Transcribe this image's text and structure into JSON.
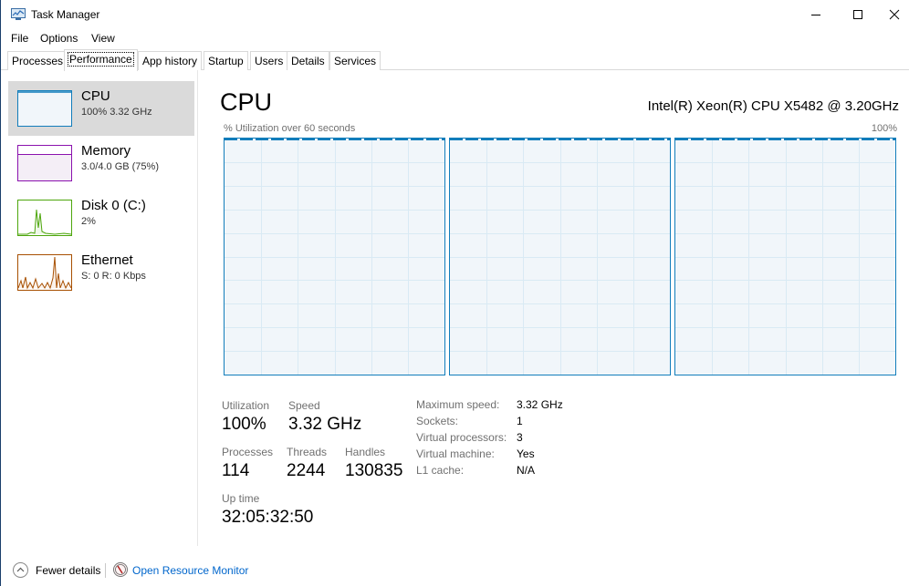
{
  "window": {
    "title": "Task Manager"
  },
  "menu": [
    "File",
    "Options",
    "View"
  ],
  "tabs": [
    "Processes",
    "Performance",
    "App history",
    "Startup",
    "Users",
    "Details",
    "Services"
  ],
  "active_tab": "Performance",
  "resources": [
    {
      "name": "CPU",
      "sub": "100%  3.32 GHz",
      "color": "#117dbb"
    },
    {
      "name": "Memory",
      "sub": "3.0/4.0 GB (75%)",
      "color": "#8b12ae"
    },
    {
      "name": "Disk 0 (C:)",
      "sub": "2%",
      "color": "#4da60c"
    },
    {
      "name": "Ethernet",
      "sub": "S: 0  R: 0 Kbps",
      "color": "#a74f01"
    }
  ],
  "cpu": {
    "title": "CPU",
    "model": "Intel(R) Xeon(R) CPU X5482 @ 3.20GHz",
    "graph_label": "% Utilization over 60 seconds",
    "graph_max": "100%",
    "utilization_label": "Utilization",
    "utilization": "100%",
    "speed_label": "Speed",
    "speed": "3.32 GHz",
    "processes_label": "Processes",
    "processes": "114",
    "threads_label": "Threads",
    "threads": "2244",
    "handles_label": "Handles",
    "handles": "130835",
    "uptime_label": "Up time",
    "uptime": "32:05:32:50",
    "info": [
      {
        "key": "Maximum speed:",
        "value": "3.32 GHz"
      },
      {
        "key": "Sockets:",
        "value": "1"
      },
      {
        "key": "Virtual processors:",
        "value": "3"
      },
      {
        "key": "Virtual machine:",
        "value": "Yes"
      },
      {
        "key": "L1 cache:",
        "value": "N/A"
      }
    ]
  },
  "footer": {
    "fewer_details": "Fewer details",
    "open_resource_monitor": "Open Resource Monitor"
  }
}
